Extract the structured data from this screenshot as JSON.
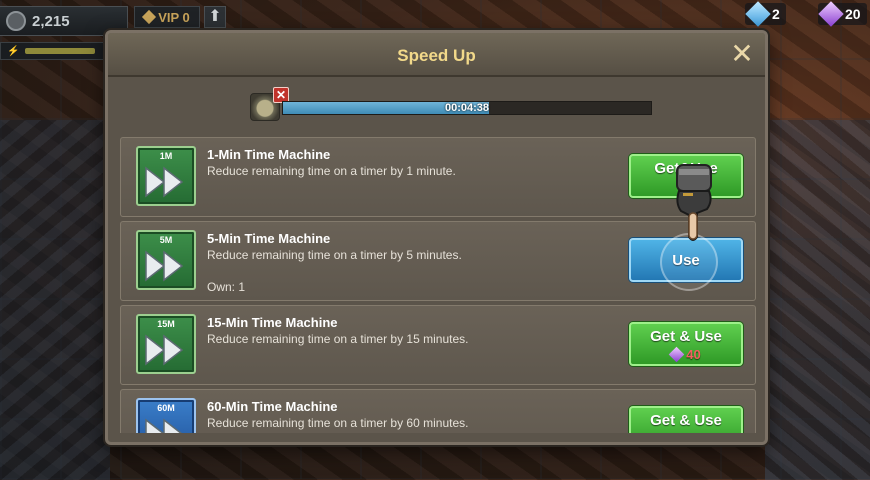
{
  "hud": {
    "power": "2,215",
    "vip": "VIP 0",
    "upgrade_arrow": "⬆",
    "resources": [
      {
        "icon": "blue-crystal-icon",
        "value": "2"
      },
      {
        "icon": "purple-gem-icon",
        "value": "20"
      }
    ]
  },
  "dialog": {
    "title": "Speed Up",
    "close": "✕",
    "timer": {
      "text": "00:04:38",
      "progress_fraction": 0.56
    },
    "cancel": "✕"
  },
  "items": [
    {
      "tag": "1M",
      "name": "1-Min Time Machine",
      "desc": "Reduce remaining time on a timer by 1 minute.",
      "own": "",
      "button": "Get&Use",
      "cost": "",
      "style": "green"
    },
    {
      "tag": "5M",
      "name": "5-Min Time Machine",
      "desc": "Reduce remaining time on a timer by 5 minutes.",
      "own": "Own: 1",
      "button": "Use",
      "cost": "",
      "style": "blue"
    },
    {
      "tag": "15M",
      "name": "15-Min Time Machine",
      "desc": "Reduce remaining time on a timer by 15 minutes.",
      "own": "",
      "button": "Get & Use",
      "cost": "40",
      "style": "green"
    },
    {
      "tag": "60M",
      "name": "60-Min Time Machine",
      "desc": "Reduce remaining time on a timer by 60 minutes.",
      "own": "",
      "button": "Get & Use",
      "cost": "",
      "style": "green"
    }
  ],
  "colors": {
    "title": "#f2d98a",
    "cost": "#f06060",
    "progress": "#3f8cb6"
  }
}
